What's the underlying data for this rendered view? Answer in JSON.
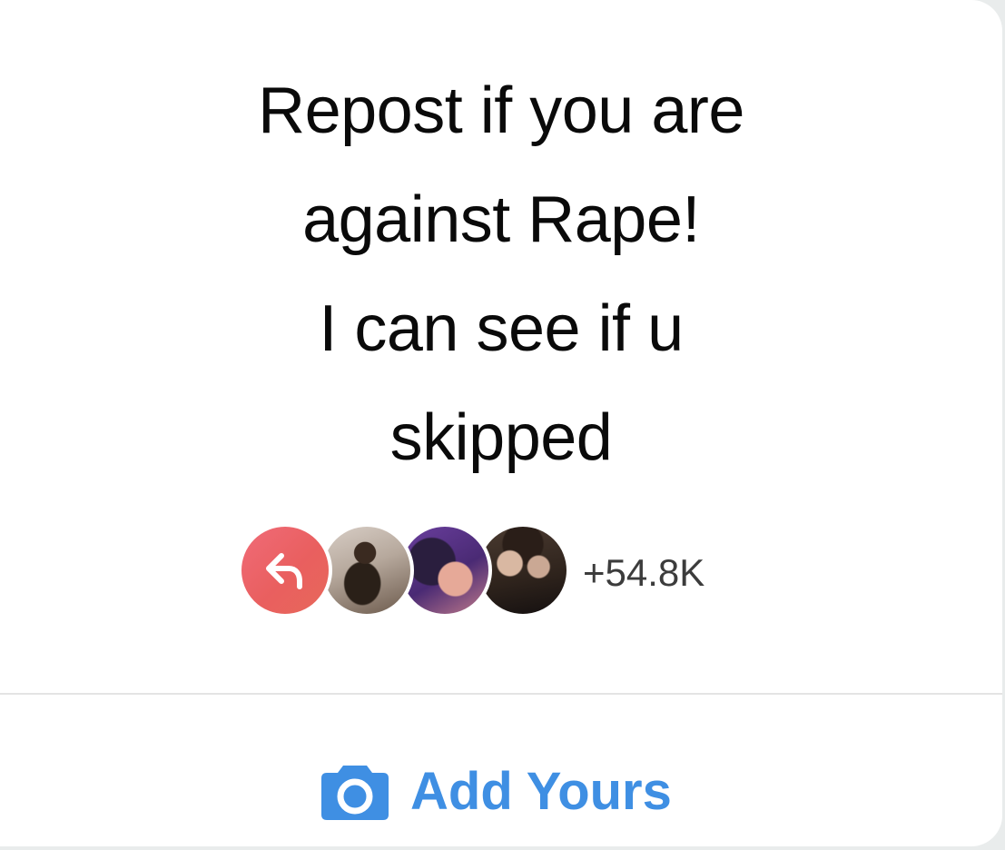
{
  "prompt": {
    "lines": [
      "Repost if you are",
      "against Rape!",
      "I can see if u",
      "skipped"
    ]
  },
  "participants": {
    "reshare_icon": "reply-arrow-icon",
    "avatars": [
      "participant-avatar",
      "participant-avatar",
      "participant-avatar"
    ],
    "count_label": "+54.8K"
  },
  "action": {
    "icon": "camera-icon",
    "label": "Add Yours"
  },
  "colors": {
    "accent": "#3f8fe3",
    "reshare_gradient_start": "#f06b78",
    "reshare_gradient_end": "#e8685a",
    "text": "#0a0a0a"
  }
}
